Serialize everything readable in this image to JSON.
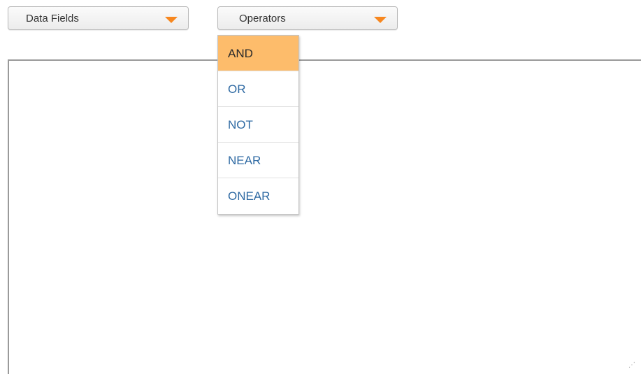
{
  "toolbar": {
    "data_fields_label": "Data Fields",
    "operators_label": "Operators"
  },
  "operators_menu": {
    "items": [
      {
        "label": "AND",
        "highlighted": true
      },
      {
        "label": "OR",
        "highlighted": false
      },
      {
        "label": "NOT",
        "highlighted": false
      },
      {
        "label": "NEAR",
        "highlighted": false
      },
      {
        "label": "ONEAR",
        "highlighted": false
      }
    ]
  },
  "editor": {
    "value": ""
  },
  "colors": {
    "accent_arrow": "#f7871f",
    "highlight": "#fdbc6b",
    "link_text": "#2f6aa3"
  },
  "icons": {
    "dropdown_arrow": "chevron-down-icon",
    "resize": "resize-grip-icon"
  }
}
